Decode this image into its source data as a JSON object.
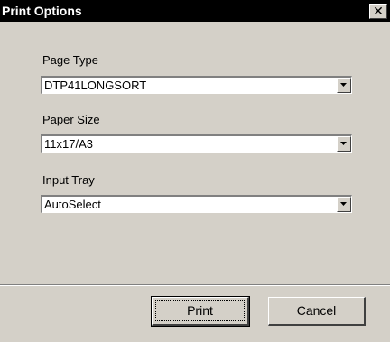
{
  "window": {
    "title": "Print Options",
    "close_glyph": "✕"
  },
  "fields": [
    {
      "label": "Page Type",
      "value": "DTP41LONGSORT"
    },
    {
      "label": "Paper Size",
      "value": "11x17/A3"
    },
    {
      "label": "Input Tray",
      "value": "AutoSelect"
    }
  ],
  "buttons": {
    "print_label": "Print",
    "cancel_label": "Cancel"
  },
  "colors": {
    "face": "#d4d0c8",
    "titlebar": "#000000"
  }
}
